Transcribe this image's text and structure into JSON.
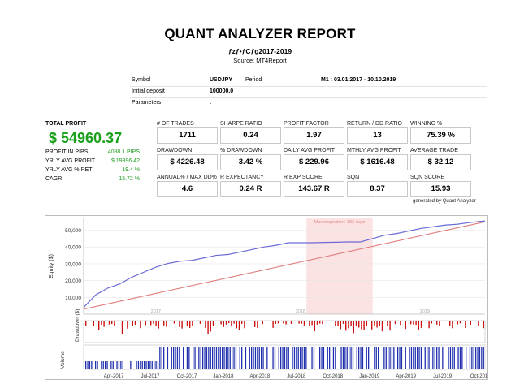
{
  "header": {
    "title": "QUANT ANALYZER REPORT",
    "subtitle": "ƒzƒ•ƒCƒg2017-2019",
    "source": "Source: MT4Report"
  },
  "info": {
    "symbol_label": "Symbol",
    "symbol_value": "USDJPY",
    "period_label": "Period",
    "period_value": "M1 : 03.01.2017 - 10.10.2019",
    "deposit_label": "Initial deposit",
    "deposit_value": "100000.0",
    "parameters_label": "Parameters",
    "parameters_value": "."
  },
  "summary": {
    "total_profit_label": "TOTAL PROFIT",
    "total_profit_value": "$ 54960.37",
    "rows": [
      {
        "label": "PROFIT IN PIPS",
        "value": "4088.1 PIPS"
      },
      {
        "label": "YRLY AVG PROFIT",
        "value": "$ 19396.42"
      },
      {
        "label": "YRLY AVG % RET",
        "value": "19.4 %"
      },
      {
        "label": "CAGR",
        "value": "15.72 %"
      }
    ]
  },
  "metrics": [
    {
      "label": "# OF TRADES",
      "value": "1711"
    },
    {
      "label": "SHARPE RATIO",
      "value": "0.24"
    },
    {
      "label": "PROFIT FACTOR",
      "value": "1.97"
    },
    {
      "label": "RETURN / DD RATIO",
      "value": "13"
    },
    {
      "label": "WINNING %",
      "value": "75.39 %"
    },
    {
      "label": "DRAWDOWN",
      "value": "$ 4226.48"
    },
    {
      "label": "% DRAWDOWN",
      "value": "3.42 %"
    },
    {
      "label": "DAILY AVG PROFIT",
      "value": "$ 229.96"
    },
    {
      "label": "MTHLY AVG PROFIT",
      "value": "$ 1616.48"
    },
    {
      "label": "AVERAGE TRADE",
      "value": "$ 32.12"
    },
    {
      "label": "ANNUAL% / MAX DD%",
      "value": "4.6"
    },
    {
      "label": "R EXPECTANCY",
      "value": "0.24 R"
    },
    {
      "label": "R EXP SCORE",
      "value": "143.67 R"
    },
    {
      "label": "SQN",
      "value": "8.37"
    },
    {
      "label": "SQN SCORE",
      "value": "15.93"
    }
  ],
  "generated_by": "generated by Quant Analyzer",
  "chart_data": {
    "type": "line",
    "equity_ylabel": "Equity ($)",
    "drawdown_ylabel": "Drawdown ($)",
    "volume_ylabel": "Volume",
    "yticks": [
      "10,000",
      "20,000",
      "30,000",
      "40,000",
      "50,000"
    ],
    "ylim": [
      0,
      57000
    ],
    "year_labels": [
      "2017",
      "2018",
      "2019"
    ],
    "xticks": [
      "Apr-2017",
      "Jul-2017",
      "Oct-2017",
      "Jan-2018",
      "Apr-2018",
      "Jul-2018",
      "Oct-2018",
      "Jan-2019",
      "Apr-2019",
      "Jul-2019",
      "Oct-201"
    ],
    "stagnation_label": "Max stagnation: 183 days",
    "colors": {
      "equity": "#6b6bd6",
      "trend": "#e07c7c",
      "drawdown": "#cc1111",
      "volume": "#1f2fae",
      "stagnation": "#fbe3e3"
    },
    "equity": {
      "x": [
        0,
        0.03,
        0.06,
        0.09,
        0.12,
        0.15,
        0.18,
        0.21,
        0.24,
        0.27,
        0.3,
        0.33,
        0.36,
        0.39,
        0.42,
        0.45,
        0.48,
        0.51,
        0.54,
        0.57,
        0.6,
        0.63,
        0.66,
        0.69,
        0.72,
        0.75,
        0.78,
        0.81,
        0.84,
        0.87,
        0.9,
        0.93,
        0.96,
        1.0
      ],
      "y": [
        4000,
        11500,
        15500,
        18000,
        22000,
        25000,
        28000,
        30200,
        31500,
        32000,
        33500,
        35000,
        35500,
        37000,
        38500,
        40000,
        41000,
        42500,
        42500,
        42500,
        42700,
        42800,
        43000,
        43000,
        45000,
        47000,
        48000,
        49500,
        51000,
        52000,
        53000,
        53500,
        54500,
        55500
      ]
    },
    "trend": {
      "x": [
        0,
        1
      ],
      "y": [
        3000,
        54960
      ]
    },
    "stagnation_range": [
      0.555,
      0.72
    ]
  }
}
